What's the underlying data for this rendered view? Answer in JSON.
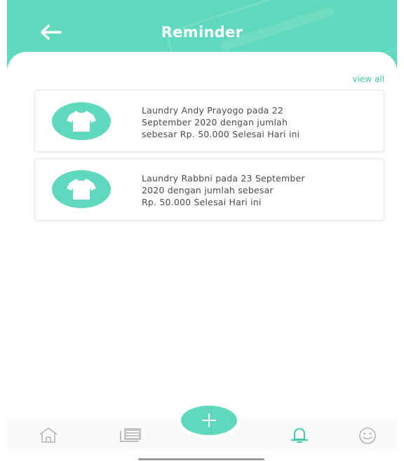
{
  "header": {
    "title": "Reminder",
    "back_icon": "arrow-left-icon",
    "color": "#5fd9bd"
  },
  "view_all_label": "view all",
  "reminders": [
    {
      "icon": "tshirt-icon",
      "lines": [
        "Laundry Andy Prayogo pada 22",
        "September 2020 dengan jumlah",
        "sebesar Rp. 50.000 Selesai Hari ini"
      ]
    },
    {
      "icon": "tshirt-icon",
      "lines": [
        "Laundry Rabbni pada 23 September",
        "2020 dengan jumlah sebesar",
        "Rp. 50.000 Selesai Hari ini"
      ]
    }
  ],
  "bottom_nav": {
    "items": [
      {
        "icon": "home-icon",
        "active": false
      },
      {
        "icon": "news-icon",
        "active": false
      },
      {
        "icon": "bell-icon",
        "active": true
      },
      {
        "icon": "smiley-icon",
        "active": false
      }
    ],
    "fab_icon": "plus-icon",
    "active_color": "#45c8aa",
    "inactive_color": "#b5b5b5"
  }
}
